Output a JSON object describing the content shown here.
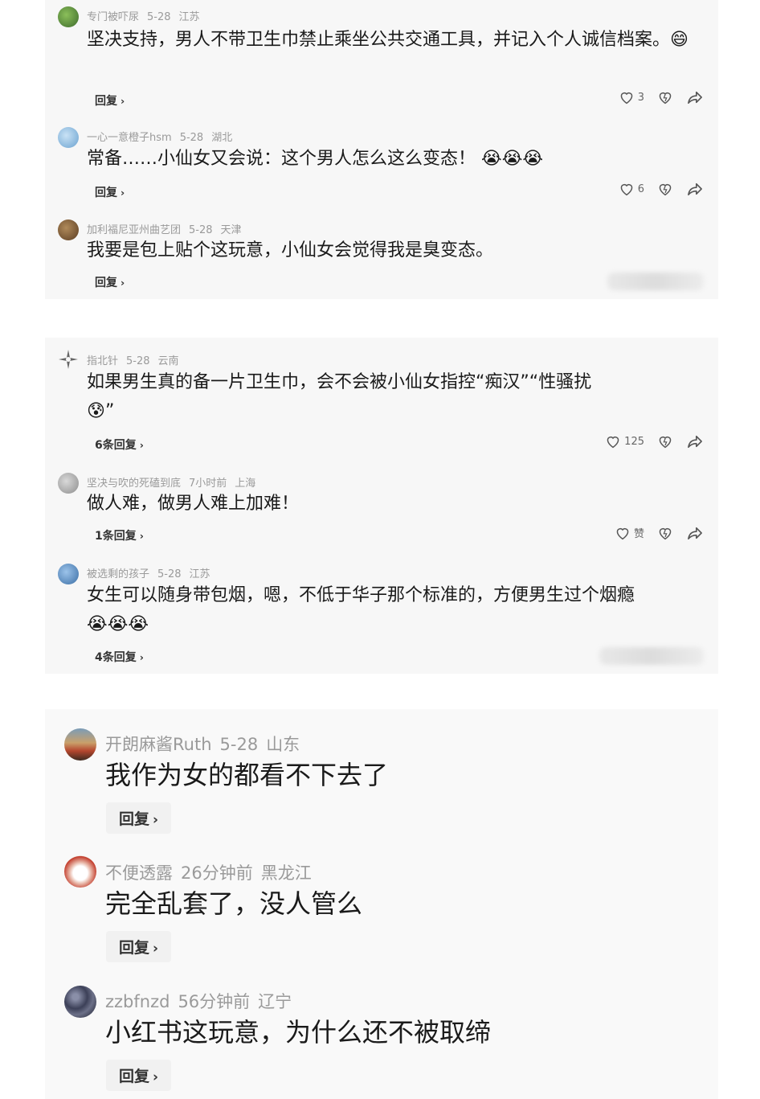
{
  "comments": [
    {
      "user": "专门被吓尿",
      "date": "5-28",
      "location": "江苏",
      "text": "坚决支持，男人不带卫生巾禁止乘坐公共交通工具，并记入个人诚信档案。",
      "emoji": "😄",
      "reply": "回复",
      "likes": "3"
    },
    {
      "user": "一心一意橙子hsm",
      "date": "5-28",
      "location": "湖北",
      "text": "常备……小仙女又会说：这个男人怎么这么变态！",
      "emoji": "😭😭😭",
      "reply": "回复",
      "likes": "6"
    },
    {
      "user": "加利福尼亚州曲艺团",
      "date": "5-28",
      "location": "天津",
      "text": "我要是包上贴个这玩意，小仙女会觉得我是臭变态。",
      "reply": "回复"
    },
    {
      "user": "指北针",
      "date": "5-28",
      "location": "云南",
      "text": "如果男生真的备一片卫生巾，会不会被小仙女指控“痴汉”“性骚扰",
      "emoji": "😰",
      "text_tail": "”",
      "reply": "6条回复",
      "likes": "125"
    },
    {
      "user": "坚决与吹的死磕到底",
      "date": "7小时前",
      "location": "上海",
      "text": "做人难，做男人难上加难！",
      "reply": "1条回复",
      "likes": "赞"
    },
    {
      "user": "被选剩的孩子",
      "date": "5-28",
      "location": "江苏",
      "text": "女生可以随身带包烟，嗯，不低于华子那个标准的，方便男生过个烟瘾",
      "emoji": "😭😭😭",
      "reply": "4条回复"
    },
    {
      "user": "开朗麻酱Ruth",
      "date": "5-28",
      "location": "山东",
      "text": "我作为女的都看不下去了",
      "reply": "回复"
    },
    {
      "user": "不便透露",
      "date": "26分钟前",
      "location": "黑龙江",
      "text": "完全乱套了，没人管么",
      "reply": "回复"
    },
    {
      "user": "zzbfnzd",
      "date": "56分钟前",
      "location": "辽宁",
      "text": "小红书这玩意，为什么还不被取缔",
      "reply": "回复"
    }
  ],
  "icons": {
    "like": "heart-icon",
    "dislike": "dislike-icon",
    "share": "share-icon",
    "chevron": "chevron-right-icon"
  }
}
